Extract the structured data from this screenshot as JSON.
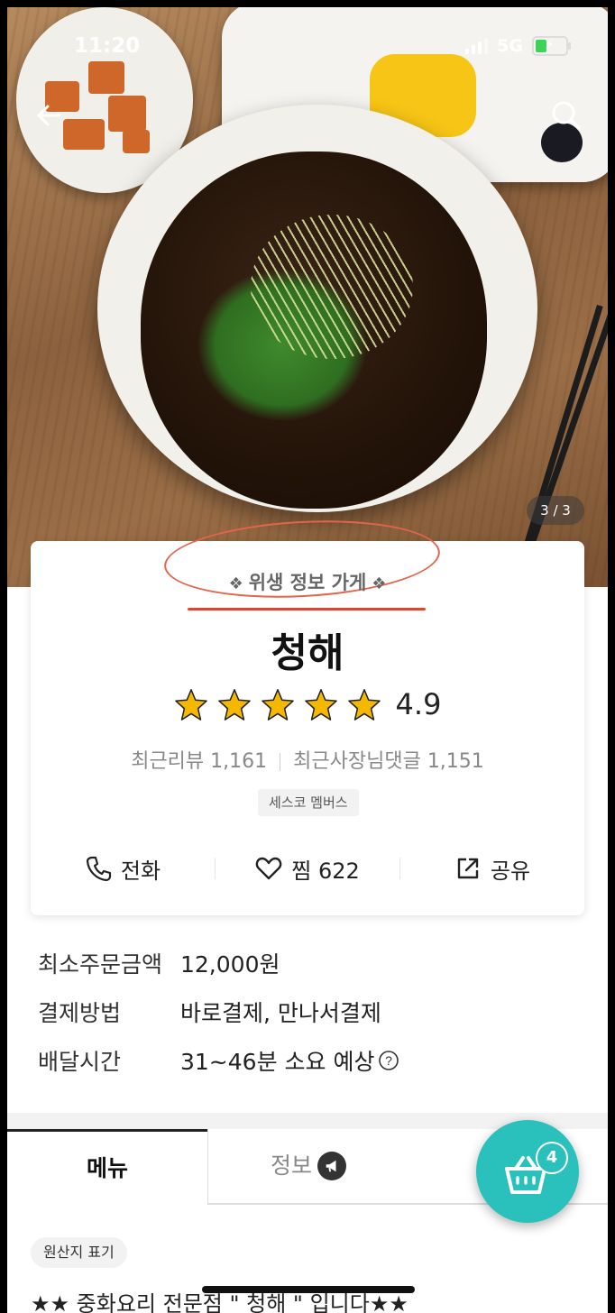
{
  "status_bar": {
    "time": "11:20",
    "network": "5G"
  },
  "hero": {
    "pager": "3 / 3"
  },
  "store": {
    "hygiene_badge": "위생 정보 가게",
    "name": "청해",
    "rating": "4.9",
    "stars_filled": 5,
    "recent_reviews": "최근리뷰 1,161",
    "recent_owner_replies": "최근사장님댓글 1,151",
    "member_badge": "세스코 멤버스"
  },
  "actions": {
    "call_label": "전화",
    "like_label": "찜 622",
    "share_label": "공유"
  },
  "order_info": [
    {
      "label": "최소주문금액",
      "value": "12,000원"
    },
    {
      "label": "결제방법",
      "value": "바로결제, 만나서결제"
    },
    {
      "label": "배달시간",
      "value": "31~46분 소요 예상"
    }
  ],
  "tabs": {
    "menu": "메뉴",
    "info": "정보"
  },
  "origin_label": "원산지 표기",
  "intro_text": "★★ 중화요리 전문점 \" 청해 \" 입니다★★",
  "cart": {
    "count": "4"
  },
  "colors": {
    "accent": "#2ac1bc",
    "star": "#f5b800",
    "annotation": "#e2452e"
  },
  "icons": [
    "back-arrow-icon",
    "search-icon",
    "phone-icon",
    "heart-icon",
    "share-icon",
    "help-circle-icon",
    "megaphone-icon",
    "cart-icon",
    "star-icon",
    "leaf-deco-icon"
  ]
}
